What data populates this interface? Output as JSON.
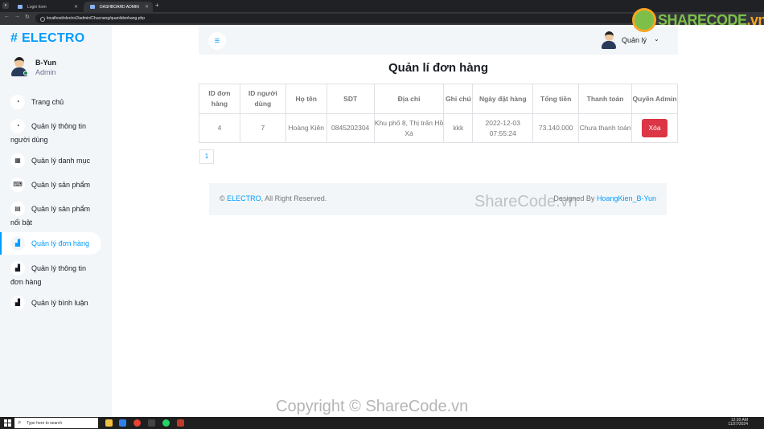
{
  "browser": {
    "tabs": [
      {
        "label": "Login form"
      },
      {
        "label": "DASHBOARD ADMIN"
      }
    ],
    "url": "localhost/electro2/admin/Chucnang/quanlidonhang.php"
  },
  "sidebar": {
    "brand": "# ELECTRO",
    "user": {
      "name": "B-Yun",
      "role": "Admin"
    },
    "items": [
      {
        "label": "Trang chủ",
        "icon": "gauge-icon"
      },
      {
        "label": "Quản lý thông tin",
        "label2": "người dùng",
        "icon": "gauge-icon"
      },
      {
        "label": "Quản lý danh mục",
        "icon": "grid-icon"
      },
      {
        "label": "Quản lý sản phẩm",
        "icon": "keyboard-icon"
      },
      {
        "label": "Quản lý sản phẩm",
        "label2": "nổi bật",
        "icon": "table-icon"
      },
      {
        "label": "Quản lý đơn hàng",
        "icon": "chart-icon"
      },
      {
        "label": "Quản lý thông tin",
        "label2": "đơn hàng",
        "icon": "chart-icon"
      },
      {
        "label": "Quản lý bình luận",
        "icon": "chart-icon"
      }
    ]
  },
  "topnav": {
    "user_label": "Quản lý"
  },
  "main": {
    "title": "Quản lí đơn hàng",
    "table": {
      "headers": [
        "ID đơn hàng",
        "ID người dùng",
        "Họ tên",
        "SDT",
        "Địa chỉ",
        "Ghi chú",
        "Ngày đặt hàng",
        "Tổng tiền",
        "Thanh toán",
        "Quyền Admin"
      ],
      "rows": [
        {
          "id": "4",
          "user_id": "7",
          "name": "Hoàng Kiên",
          "phone": "0845202304",
          "address": "Khu phố 8, Thị trấn Hồ Xá",
          "note": "kkk",
          "date": "2022-12-03 07:55:24",
          "total": "73.140.000",
          "payment": "Chưa thanh toán",
          "action": "Xóa"
        }
      ]
    },
    "pagination": [
      "1"
    ]
  },
  "footer": {
    "copyright_prefix": "©",
    "brand_link": "ELECTRO",
    "copyright_suffix": ", All Right Reserved.",
    "designed_prefix": "Designed By",
    "designer_link": "HoangKien_B-Yun"
  },
  "watermarks": {
    "logo_text_a": "SHARECODE",
    "logo_text_b": ".vn",
    "mid": "ShareCode.vn",
    "bottom": "Copyright © ShareCode.vn"
  },
  "taskbar": {
    "search_placeholder": "Type here to search",
    "time": "12:30 AM",
    "date": "11/27/2024"
  },
  "colors": {
    "accent": "#009cff",
    "danger": "#dc3545",
    "bg": "#f3f6f9"
  }
}
